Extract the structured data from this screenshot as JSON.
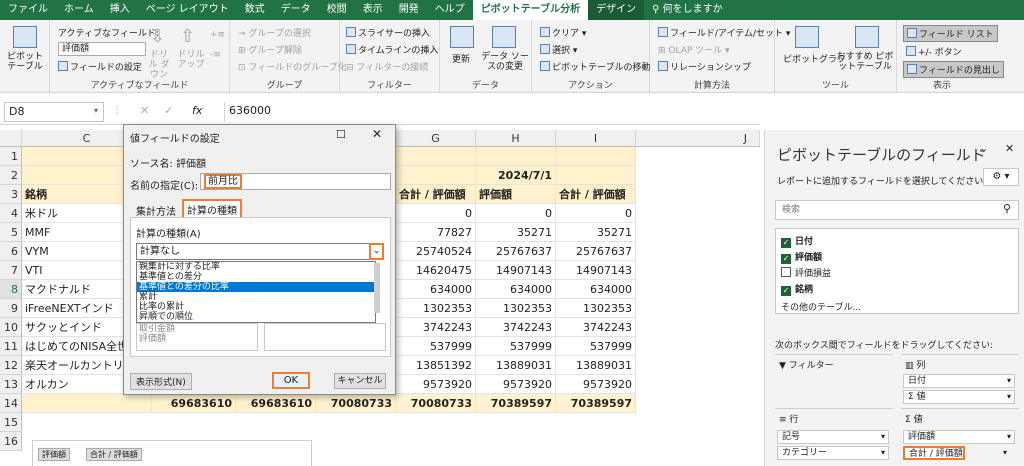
{
  "ribbon_tabs": [
    "ファイル",
    "ホーム",
    "挿入",
    "ページ レイアウト",
    "数式",
    "データ",
    "校閲",
    "表示",
    "開発",
    "ヘルプ",
    "ピボットテーブル分析",
    "デザイン",
    "何をしますか"
  ],
  "ribbon": {
    "pivottable": {
      "label": "ピボットテーブル",
      "group": ""
    },
    "active_field": {
      "label": "アクティブなフィールド:",
      "value": "評価額",
      "settings": "フィールドの設定",
      "drilldown": "ドリル ダウン",
      "drillup": "ドリル アップ",
      "group": "アクティブなフィールド"
    },
    "grouping": {
      "sel": "グループの選択",
      "ungroup": "グループ解除",
      "field": "フィールドのグループ化",
      "group": "グループ"
    },
    "filter": {
      "slicer": "スライサーの挿入",
      "timeline": "タイムラインの挿入",
      "conn": "フィルターの接続",
      "group": "フィルター"
    },
    "data": {
      "refresh": "更新",
      "source": "データ ソースの変更",
      "group": "データ"
    },
    "action": {
      "clear": "クリア",
      "select": "選択",
      "move": "ピボットテーブルの移動",
      "group": "アクション"
    },
    "calc": {
      "fields": "フィールド/アイテム/セット",
      "olap": "OLAP ツール",
      "rel": "リレーションシップ",
      "group": "計算方法"
    },
    "tools": {
      "chart": "ピボットグラフ",
      "rec": "おすすめ ピボットテーブル",
      "group": "ツール"
    },
    "show": {
      "list": "フィールド リスト",
      "btn": "+/- ボタン",
      "hdr": "フィールドの見出し",
      "group": "表示"
    }
  },
  "formula_bar": {
    "name": "D8",
    "fx": "fx",
    "value": "636000"
  },
  "grid": {
    "columns": [
      "C",
      "D",
      "E",
      "F",
      "G",
      "H",
      "I",
      "J"
    ],
    "rows": [
      "1",
      "2",
      "3",
      "4",
      "5",
      "6",
      "7",
      "8",
      "9",
      "10",
      "11",
      "12",
      "13",
      "14",
      "15",
      "16"
    ],
    "date_header": "2024/7/1",
    "col_headers": [
      "合計 / 評価額",
      "評価額",
      "合計 / 評価額"
    ],
    "label_header": "銘柄",
    "names": [
      "米ドル",
      "MMF",
      "VYM",
      "VTI",
      "マクドナルド",
      "iFreeNEXTインド",
      "サクッとインド",
      "はじめてのNISA全世",
      "楽天オールカントリ",
      "オルカン"
    ],
    "g": [
      "0",
      "77827",
      "25740524",
      "14620475",
      "634000",
      "1302353",
      "3742243",
      "537999",
      "13851392",
      "9573920"
    ],
    "h": [
      "0",
      "35271",
      "25767637",
      "14907143",
      "634000",
      "1302353",
      "3742243",
      "537999",
      "13889031",
      "9573920"
    ],
    "i": [
      "0",
      "35271",
      "25767637",
      "14907143",
      "634000",
      "1302353",
      "3742243",
      "537999",
      "13889031",
      "9573920"
    ],
    "totals": [
      "69683610",
      "69683610",
      "70080733",
      "70080733",
      "70389597",
      "70389597"
    ],
    "bottom_labels": [
      "評価額",
      "合計 / 評価額"
    ]
  },
  "dialog": {
    "title": "値フィールドの設定",
    "source_label": "ソース名:",
    "source": "評価額",
    "name_label": "名前の指定(C):",
    "name_value": "前月比",
    "tabs": [
      "集計方法",
      "計算の種類"
    ],
    "calc_label": "計算の種類(A)",
    "calc_value": "計算なし",
    "options": [
      "親集計に対する比率",
      "基準値との差分",
      "基準値との差分の比率",
      "累計",
      "比率の累計",
      "昇順での順位"
    ],
    "hidden_items": [
      "取引金額",
      "評価額"
    ],
    "number_format": "表示形式(N)",
    "ok": "OK",
    "cancel": "キャンセル"
  },
  "panel": {
    "title": "ピボットテーブルのフィールド",
    "desc": "レポートに追加するフィールドを選択してください:",
    "search": "検索",
    "fields": [
      {
        "name": "日付",
        "checked": true
      },
      {
        "name": "評価額",
        "checked": true
      },
      {
        "name": "評価損益",
        "checked": false
      },
      {
        "name": "銘柄",
        "checked": true
      }
    ],
    "more": "その他のテーブル...",
    "drag_hint": "次のボックス間でフィールドをドラッグしてください:",
    "filter": "フィルター",
    "columns": "列",
    "rows": "行",
    "values": "値",
    "col_items": [
      "日付",
      "Σ 値"
    ],
    "row_items": [
      "記号",
      "カテゴリー"
    ],
    "val_items": [
      "評価額",
      "合計 / 評価額"
    ]
  }
}
